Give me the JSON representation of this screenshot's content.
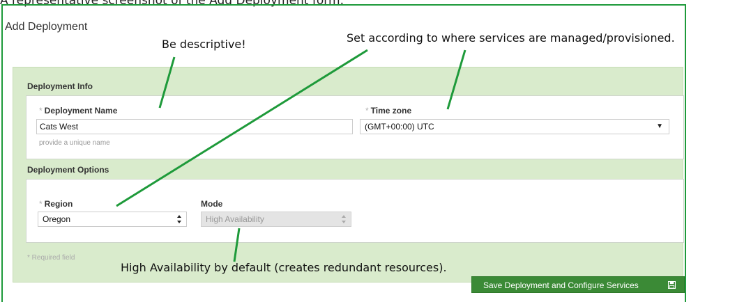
{
  "top_caption": "A representative screenshot of the Add Deployment form:",
  "page_title": "Add Deployment",
  "sections": {
    "info": {
      "title": "Deployment Info"
    },
    "options": {
      "title": "Deployment Options"
    }
  },
  "fields": {
    "deployment_name": {
      "label": "Deployment Name",
      "value": "Cats West",
      "help": "provide a unique name"
    },
    "time_zone": {
      "label": "Time zone",
      "value": "(GMT+00:00) UTC"
    },
    "region": {
      "label": "Region",
      "value": "Oregon"
    },
    "mode": {
      "label": "Mode",
      "value": "High Availability"
    }
  },
  "required_marker": "*",
  "required_note": "* Required field",
  "save_button": {
    "label": "Save Deployment and Configure Services",
    "icon": "floppy-disk-icon"
  },
  "annotations": {
    "name": "Be descriptive!",
    "timezone": "Set according to where services are managed/provisioned.",
    "mode": "High Availability by default (creates redundant resources)."
  },
  "colors": {
    "annotation_green": "#1e9a3a",
    "panel_green": "#d9ebcc",
    "button_green": "#3b8a36"
  }
}
